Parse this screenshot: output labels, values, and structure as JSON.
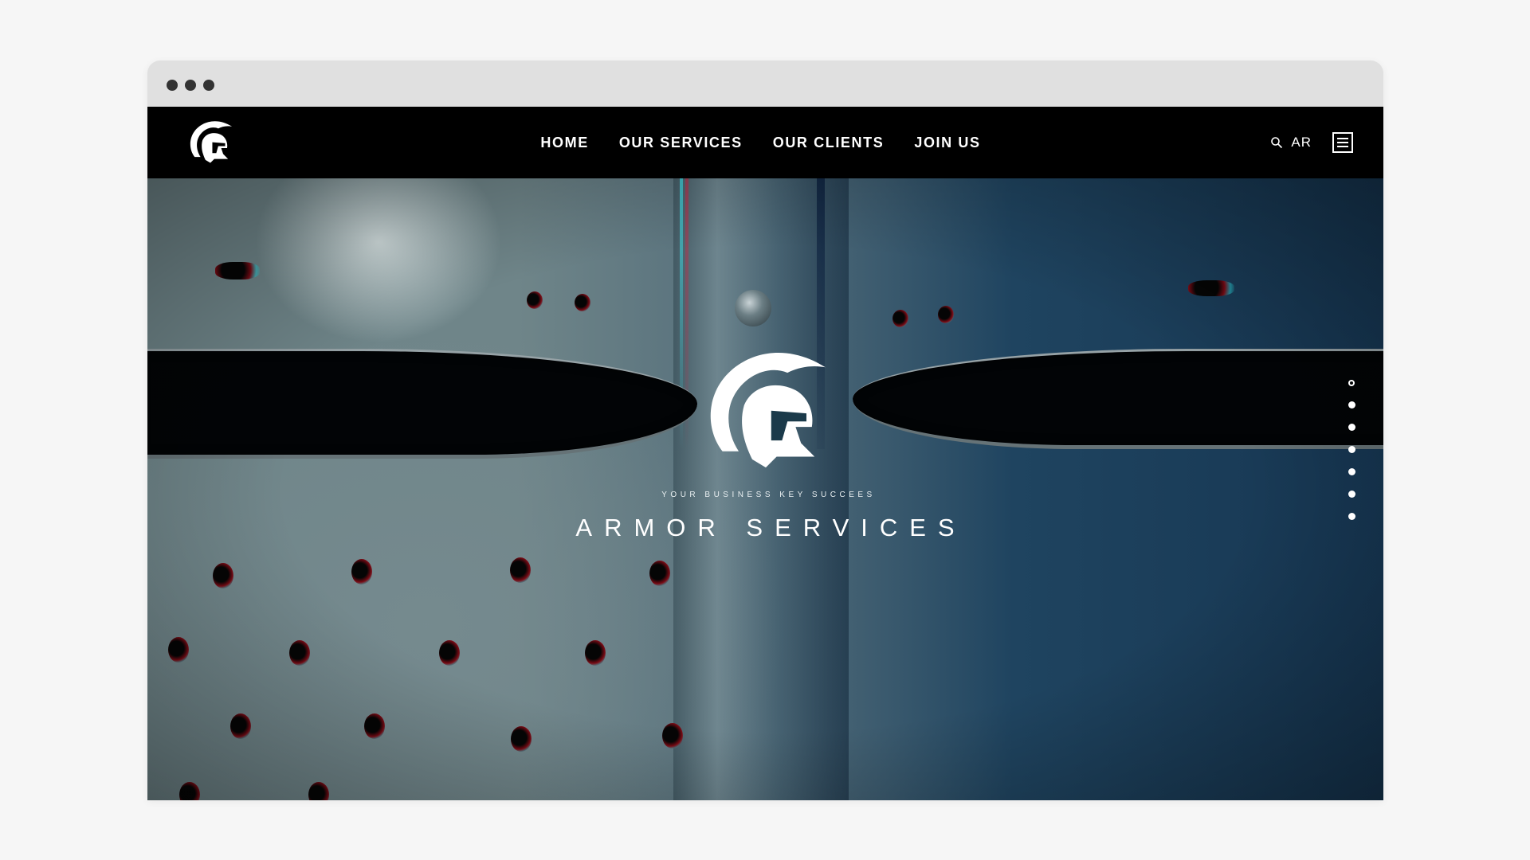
{
  "window": {
    "controls": [
      "dot",
      "dot",
      "dot"
    ]
  },
  "nav": {
    "logo_icon": "spartan-helmet-icon",
    "items": [
      {
        "label": "HOME"
      },
      {
        "label": "OUR SERVICES"
      },
      {
        "label": "OUR CLIENTS"
      },
      {
        "label": "JOIN US"
      }
    ],
    "search_icon": "search-icon",
    "language": "AR",
    "menu_icon": "hamburger-menu-icon"
  },
  "hero": {
    "emblem_icon": "spartan-helmet-icon",
    "tagline": "YOUR BUSINESS KEY SUCCEES",
    "title": "ARMOR SERVICES",
    "slides_total": 7,
    "slide_active": 1
  },
  "colors": {
    "nav_background": "#000000",
    "text": "#ffffff",
    "browser_chrome": "#e0e0e0",
    "page_background": "#f6f6f6"
  }
}
